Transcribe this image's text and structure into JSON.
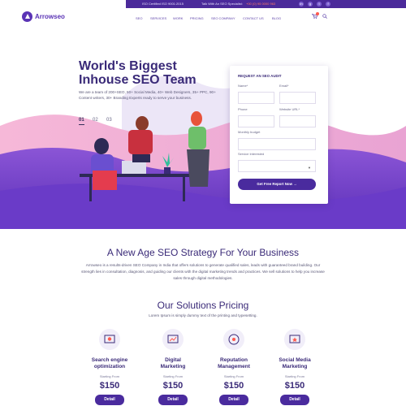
{
  "topbar": {
    "iso": "ISO Certified ISO 9001:2015",
    "talk": "Talk With An SEO Specialist:",
    "phone": "+00 (0) 95 0000 963",
    "social": [
      "in",
      "g",
      "t",
      "f"
    ]
  },
  "brand": {
    "name": "Arrowseo"
  },
  "nav": {
    "items": [
      "SEO",
      "SERVICES",
      "WORK",
      "PRICING",
      "SEO COMPANY",
      "CONTACT US",
      "BLOG"
    ]
  },
  "hero": {
    "title_line1": "World's Biggest",
    "title_line2": "Inhouse SEO Team",
    "description": "We are a team of 200+SEO, 50+ Social Media, 40+ Web Designers, 35+ PPC, 90+ Content writers, 30+ Branding Experts ready to serve your business.",
    "slides": [
      "01",
      "02",
      "03"
    ],
    "active_slide": "01"
  },
  "form": {
    "title": "REQUEST AN SEO AUDIT",
    "name_label": "Name*",
    "email_label": "Email*",
    "phone_label": "Phone",
    "website_label": "Website URL*",
    "budget_label": "Monthly budget",
    "service_label": "Service Interested",
    "service_value": "",
    "submit_label": "Get Free Report Now →"
  },
  "strategy": {
    "title": "A New Age SEO Strategy For Your Business",
    "description": "Arrowseo is a results-driven SEO Company in India that offers solutions to generate qualified sales, leads with guaranteed brand building. Our strength lies in consultation, diagnosis, and guiding our clients with the digital marketing trends and practices. We sell solutions to help you increase sales through digital methodologies."
  },
  "pricing": {
    "title": "Our Solutions Pricing",
    "subtitle": "Lorem Ipsum is simply dummy text of the printing and typesetting.",
    "plans": [
      {
        "line1": "Search engine",
        "line2": "optimization",
        "start": "Starting From",
        "price": "$150",
        "button": "Detail",
        "icon": "seo-icon"
      },
      {
        "line1": "Digital",
        "line2": "Marketing",
        "start": "Starting From",
        "price": "$150",
        "button": "Detail",
        "icon": "digital-marketing-icon"
      },
      {
        "line1": "Reputation",
        "line2": "Management",
        "start": "Starting From",
        "price": "$150",
        "button": "Detail",
        "icon": "reputation-icon"
      },
      {
        "line1": "Social Media",
        "line2": "Marketing",
        "start": "Starting From",
        "price": "$150",
        "button": "Detail",
        "icon": "social-media-icon"
      }
    ]
  },
  "colors": {
    "primary": "#4a2b9e",
    "accent": "#ff5a4e",
    "hero_pink": "#f3a8cf",
    "hero_purple": "#6a3cc4"
  }
}
